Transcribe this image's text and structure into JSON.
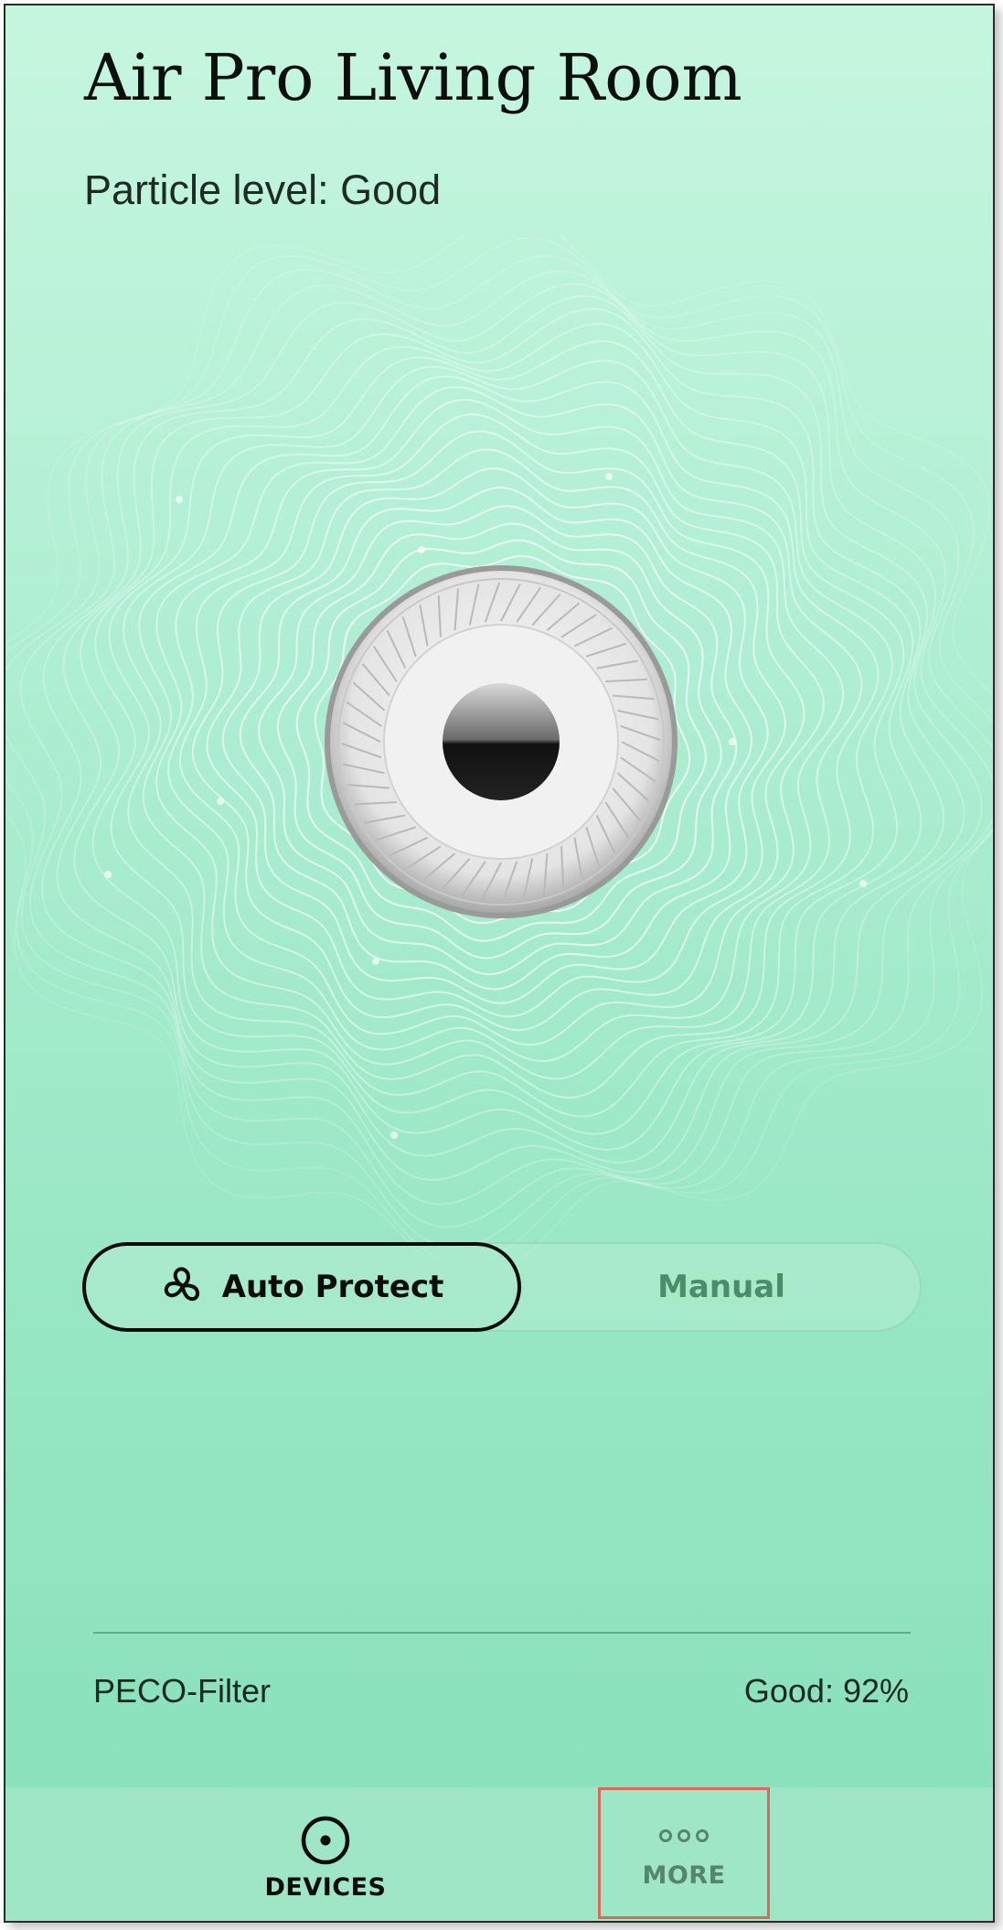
{
  "device": {
    "title": "Air Pro Living Room",
    "particle_level": "Particle level: Good"
  },
  "mode_toggle": {
    "auto_label": "Auto Protect",
    "manual_label": "Manual",
    "selected": "Auto Protect",
    "auto_icon": "fan-icon"
  },
  "filter": {
    "name": "PECO-Filter",
    "status": "Good: 92%"
  },
  "bottom_nav": {
    "items": [
      {
        "label": "DEVICES",
        "icon": "target-icon",
        "active": true
      },
      {
        "label": "MORE",
        "icon": "more-dots-icon",
        "active": false
      }
    ]
  },
  "colors": {
    "background_top": "#c6f6df",
    "background_bottom": "#86e0b9",
    "nav_background": "#9ee6c5",
    "highlight_box": "#d9695a"
  }
}
